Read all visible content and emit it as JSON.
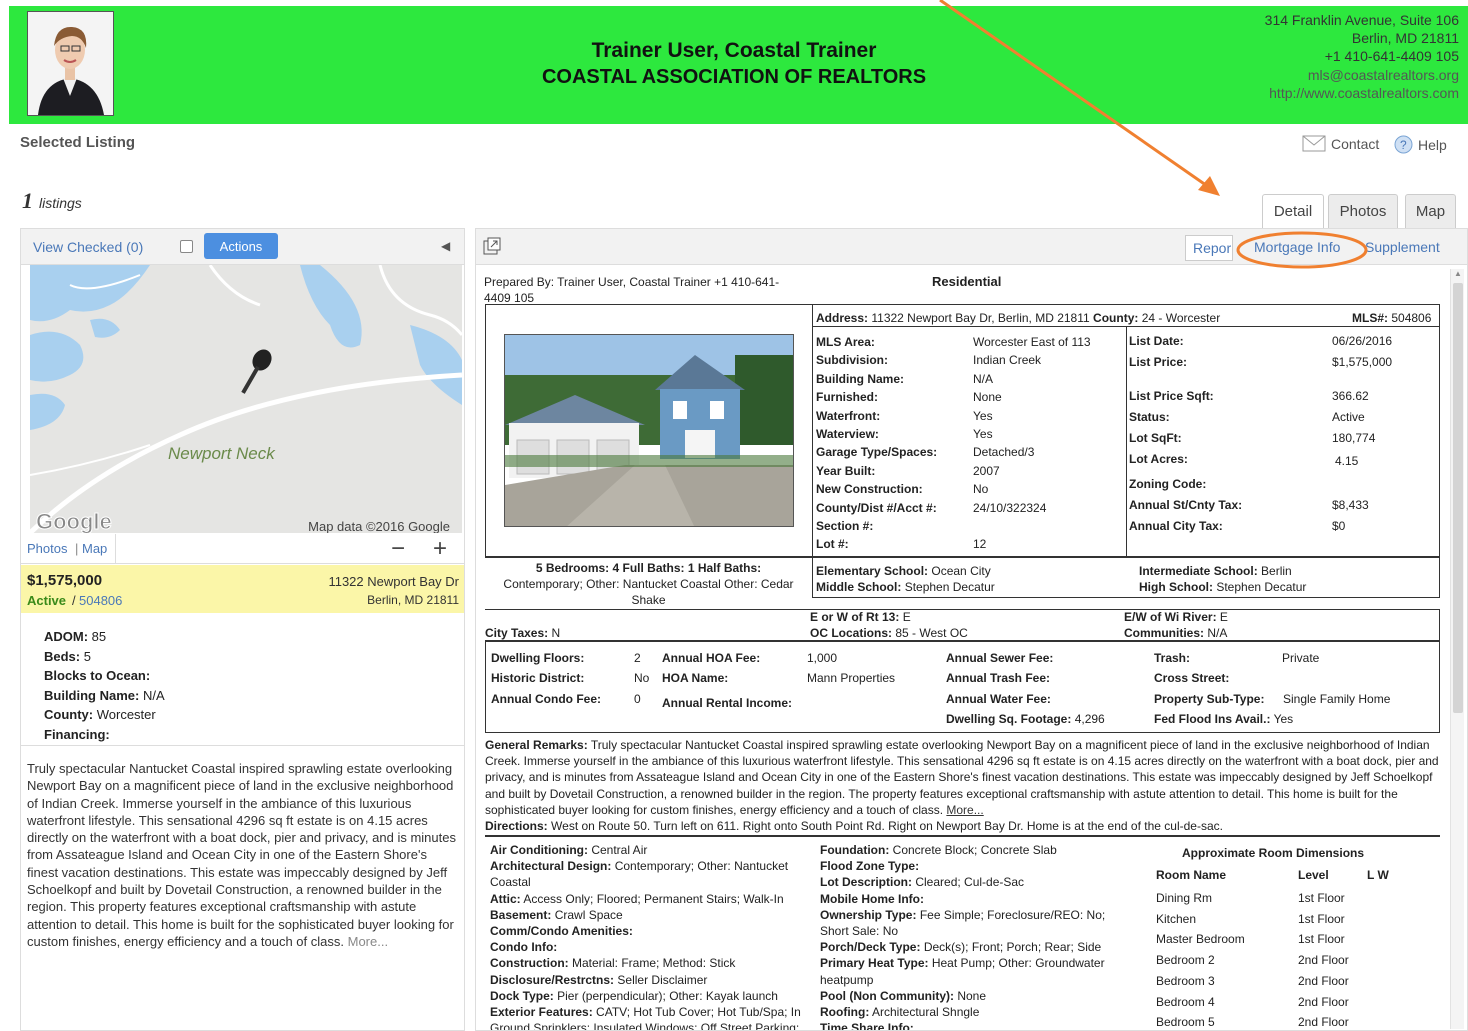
{
  "header": {
    "name": "Trainer User, Coastal Trainer",
    "org": "COASTAL ASSOCIATION OF REALTORS",
    "address_lines": [
      "314 Franklin Avenue, Suite 106",
      "Berlin, MD 21811",
      "+1 410-641-4409 105"
    ],
    "email": "mls@coastalrealtors.org",
    "url": "http://www.coastalrealtors.com",
    "bg_color": "#2de83e"
  },
  "toolbar": {
    "selected": "Selected Listing",
    "contact": "Contact",
    "help": "Help",
    "count": "1",
    "count_label": "listings"
  },
  "tabs": {
    "detail": "Detail",
    "photos": "Photos",
    "map": "Map"
  },
  "left": {
    "view_checked": "View Checked (0)",
    "actions": "Actions",
    "map_place": "Newport Neck",
    "map_logo": "Google",
    "map_credit": "Map data ©2016 Google",
    "photos_link": "Photos",
    "sep": "|",
    "map_link": "Map",
    "zoom_out": "−",
    "zoom_in": "+",
    "price": "$1,575,000",
    "status": "Active",
    "status_sep": "/",
    "mls": "504806",
    "street": "11322 Newport Bay Dr",
    "city": "Berlin, MD 21811",
    "facts": [
      {
        "k": "ADOM:",
        "v": "85"
      },
      {
        "k": "Beds:",
        "v": "5"
      },
      {
        "k": "Blocks to Ocean:",
        "v": ""
      },
      {
        "k": "Building Name:",
        "v": "N/A"
      },
      {
        "k": "County:",
        "v": "Worcester"
      },
      {
        "k": "Financing:",
        "v": ""
      }
    ],
    "remarks": "Truly spectacular Nantucket Coastal inspired sprawling estate overlooking Newport Bay on a magnificent piece of land in the exclusive neighborhood of Indian Creek. Immerse yourself in the ambiance of this luxurious waterfront lifestyle. This sensational 4296 sq ft estate is on 4.15 acres directly on the waterfront with a boat dock, pier and privacy, and is minutes from Assateague Island and Ocean City in one of the Eastern Shore's finest vacation destinations. This estate was impeccably designed by Jeff Schoelkopf and built by Dovetail Construction, a renowned builder in the region. This property features exceptional craftsmanship with astute attention to detail. This home is built for the sophisticated buyer looking for custom finishes, energy efficiency and a touch of class.",
    "more": "More..."
  },
  "right_tabs": {
    "report": "Repor",
    "mortgage": "Mortgage Info",
    "supplement": "Supplement"
  },
  "annotation": {
    "arrow_color": "#f08030",
    "circle_color": "#f08030"
  },
  "report": {
    "prepared_by": "Prepared By: Trainer User, Coastal Trainer +1 410-641-4409 105",
    "type": "Residential",
    "address_label": "Address:",
    "address": "11322 Newport Bay Dr, Berlin, MD 21811",
    "county_label": "County:",
    "county": "24 - Worcester",
    "mls_label": "MLS#:",
    "mls": "504806",
    "mid": [
      {
        "k": "MLS Area:",
        "v": "Worcester East of 113"
      },
      {
        "k": "Subdivision:",
        "v": "Indian Creek"
      },
      {
        "k": "Building Name:",
        "v": "N/A"
      },
      {
        "k": "Furnished:",
        "v": "None"
      },
      {
        "k": "Waterfront:",
        "v": "Yes"
      },
      {
        "k": "Waterview:",
        "v": "Yes"
      },
      {
        "k": "Garage Type/Spaces:",
        "v": "Detached/3"
      },
      {
        "k": "Year Built:",
        "v": "2007"
      },
      {
        "k": "New Construction:",
        "v": "No"
      },
      {
        "k": "County/Dist #/Acct #:",
        "v": "24/10/322324"
      },
      {
        "k": "Section #:",
        "v": ""
      },
      {
        "k": "Lot #:",
        "v": "12"
      }
    ],
    "rightcol": [
      {
        "k": "List Date:",
        "v": "06/26/2016"
      },
      {
        "k": "List Price:",
        "v": "$1,575,000"
      },
      {
        "k": "List Price Sqft:",
        "v": "366.62"
      },
      {
        "k": "Status:",
        "v": "Active"
      },
      {
        "k": "Lot SqFt:",
        "v": "180,774"
      },
      {
        "k": "Lot Acres:",
        "v": "4.15"
      },
      {
        "k": "Zoning Code:",
        "v": ""
      },
      {
        "k": "Annual St/Cnty Tax:",
        "v": "$8,433"
      },
      {
        "k": "Annual City Tax:",
        "v": "$0"
      }
    ],
    "beds_line": "5 Bedrooms: 4 Full Baths: 1 Half Baths:",
    "style_line": "Contemporary; Other: Nantucket Coastal Other: Cedar Shake",
    "elem_label": "Elementary School:",
    "elem": "Ocean City",
    "middle_label": "Middle School:",
    "middle": "Stephen Decatur",
    "inter_label": "Intermediate School:",
    "inter": "Berlin",
    "high_label": "High School:",
    "high": "Stephen Decatur",
    "eow_label": "E or W of Rt 13:",
    "eow": "E",
    "oc_label": "OC Locations:",
    "oc": "85 - West OC",
    "ew_label": "E/W of Wi River:",
    "ew": "E",
    "comm_label": "Communities:",
    "comm": "N/A",
    "citytax_label": "City Taxes:",
    "citytax": "N",
    "fees": {
      "floors_k": "Dwelling Floors:",
      "floors_v": "2",
      "hoa_k": "Annual HOA Fee:",
      "hoa_v": "1,000",
      "sewer_k": "Annual Sewer Fee:",
      "trash_k": "Trash:",
      "trash_v": "Private",
      "hist_k": "Historic District:",
      "hist_v": "No",
      "hoaname_k": "HOA Name:",
      "hoaname_v": "Mann Properties",
      "trashfee_k": "Annual Trash Fee:",
      "cross_k": "Cross Street:",
      "condo_k": "Annual Condo Fee:",
      "condo_v": "0",
      "rental_k": "Annual Rental Income:",
      "water_k": "Annual Water Fee:",
      "subtype_k": "Property Sub-Type:",
      "subtype_v": "Single Family Home",
      "sqft_k": "Dwelling Sq. Footage:",
      "sqft_v": "4,296",
      "flood_k": "Fed Flood Ins Avail.:",
      "flood_v": "Yes"
    },
    "gen_label": "General Remarks:",
    "gen": "Truly spectacular Nantucket Coastal inspired sprawling estate overlooking Newport Bay on a magnificent piece of land in the exclusive neighborhood of Indian Creek. Immerse yourself in the ambiance of this luxurious waterfront lifestyle. This sensational 4296 sq ft estate is on 4.15 acres directly on the waterfront with a boat dock, pier and privacy, and is minutes from Assateague Island and Ocean City in one of the Eastern Shore's finest vacation destinations. This estate was impeccably designed by Jeff Schoelkopf and built by Dovetail Construction, a renowned builder in the region. The property features exceptional craftsmanship with astute attention to detail. This home is built for the sophisticated buyer looking for custom finishes, energy efficiency and a touch of class.",
    "gen_more": "More...",
    "dir_label": "Directions:",
    "dir": "West on Route 50. Turn left on 611. Right onto South Point Rd. Right on Newport Bay Dr. Home is at the end of the cul-de-sac.",
    "feat_left": [
      {
        "k": "Air Conditioning:",
        "v": "Central Air"
      },
      {
        "k": "Architectural Design:",
        "v": "Contemporary; Other: Nantucket Coastal"
      },
      {
        "k": "Attic:",
        "v": "Access Only; Floored; Permanent Stairs; Walk-In"
      },
      {
        "k": "Basement:",
        "v": "Crawl Space"
      },
      {
        "k": "Comm/Condo Amenities:",
        "v": ""
      },
      {
        "k": "Condo Info:",
        "v": ""
      },
      {
        "k": "Construction:",
        "v": "Material: Frame; Method: Stick"
      },
      {
        "k": "Disclosure/Restrctns:",
        "v": "Seller Disclaimer"
      },
      {
        "k": "Dock Type:",
        "v": "Pier (perpendicular); Other: Kayak launch"
      },
      {
        "k": "Exterior Features:",
        "v": "CATV; Hot Tub Cover; Hot Tub/Spa; In Ground Sprinklers; Insulated Windows; Off Street Parking;"
      }
    ],
    "feat_mid": [
      {
        "k": "Foundation:",
        "v": "Concrete Block; Concrete Slab"
      },
      {
        "k": "Flood Zone Type:",
        "v": ""
      },
      {
        "k": "Lot Description:",
        "v": "Cleared; Cul-de-Sac"
      },
      {
        "k": "Mobile Home Info:",
        "v": ""
      },
      {
        "k": "Ownership Type:",
        "v": "Fee Simple; Foreclosure/REO: No; Short Sale: No"
      },
      {
        "k": "Porch/Deck Type:",
        "v": "Deck(s); Front; Porch; Rear; Side"
      },
      {
        "k": "Primary Heat Type:",
        "v": "Heat Pump; Other: Groundwater heatpump"
      },
      {
        "k": "Pool (Non Community):",
        "v": "None"
      },
      {
        "k": "Roofing:",
        "v": "Architectural Shngle"
      },
      {
        "k": "Time Share Info:",
        "v": ""
      }
    ],
    "rooms_title": "Approximate Room Dimensions",
    "rooms_head": {
      "name": "Room Name",
      "level": "Level",
      "lw": "L  W"
    },
    "rooms": [
      {
        "name": "Dining Rm",
        "level": "1st Floor"
      },
      {
        "name": "Kitchen",
        "level": "1st Floor"
      },
      {
        "name": "Master Bedroom",
        "level": "1st Floor"
      },
      {
        "name": "Bedroom 2",
        "level": "2nd Floor"
      },
      {
        "name": "Bedroom 3",
        "level": "2nd Floor"
      },
      {
        "name": "Bedroom 4",
        "level": "2nd Floor"
      },
      {
        "name": "Bedroom 5",
        "level": "2nd Floor"
      }
    ]
  }
}
